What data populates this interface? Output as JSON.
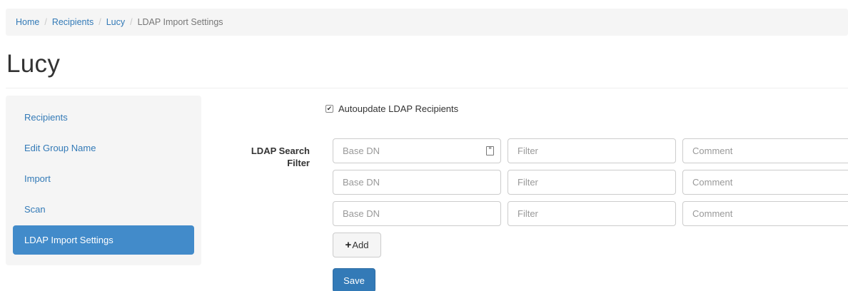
{
  "breadcrumb": {
    "items": [
      "Home",
      "Recipients",
      "Lucy"
    ],
    "current": "LDAP Import Settings"
  },
  "page": {
    "title": "Lucy"
  },
  "sidebar": {
    "items": [
      {
        "label": "Recipients"
      },
      {
        "label": "Edit Group Name"
      },
      {
        "label": "Import"
      },
      {
        "label": "Scan"
      },
      {
        "label": "LDAP Import Settings",
        "active": true
      }
    ]
  },
  "form": {
    "autoupdate": {
      "label": "Autoupdate LDAP Recipients",
      "checked": true
    },
    "ldap_filter_label": "LDAP Search Filter",
    "rows": [
      {
        "base_dn": "",
        "filter": "",
        "comment": ""
      },
      {
        "base_dn": "",
        "filter": "",
        "comment": ""
      },
      {
        "base_dn": "",
        "filter": "",
        "comment": ""
      }
    ],
    "placeholders": {
      "base_dn": "Base DN",
      "filter": "Filter",
      "comment": "Comment"
    },
    "add_label": "Add",
    "save_label": "Save"
  },
  "colors": {
    "accent": "#337ab7",
    "active_nav": "#428bca",
    "panel_bg": "#f5f5f5"
  }
}
